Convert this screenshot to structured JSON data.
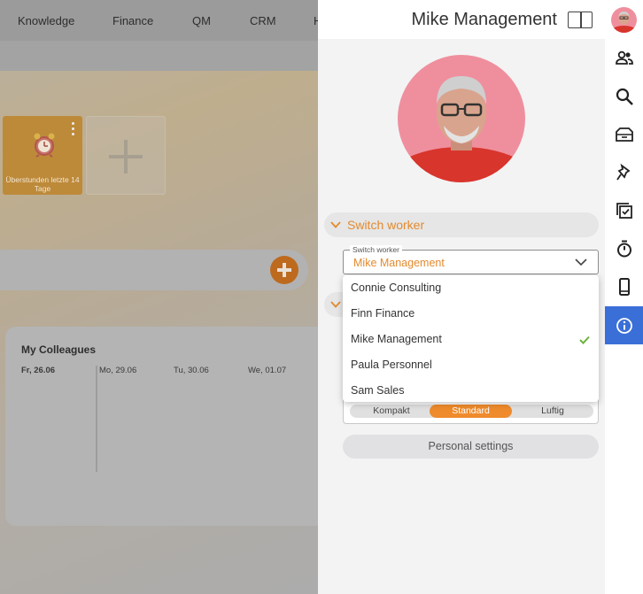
{
  "topnav": {
    "items": [
      "Knowledge",
      "Finance",
      "QM",
      "CRM",
      "H"
    ]
  },
  "dashboard": {
    "tile_label": "Überstunden letzte 14 Tage",
    "colleagues_title": "My Colleagues",
    "days": [
      "Fr, 26.06",
      "Mo, 29.06",
      "Tu, 30.06",
      "We, 01.07"
    ]
  },
  "panel": {
    "user_name": "Mike Management",
    "switch_section": "Switch worker",
    "select": {
      "label": "Switch worker",
      "value": "Mike Management"
    },
    "options": [
      {
        "label": "Connie Consulting",
        "selected": false
      },
      {
        "label": "Finn Finance",
        "selected": false
      },
      {
        "label": "Mike Management",
        "selected": true
      },
      {
        "label": "Paula Personnel",
        "selected": false
      },
      {
        "label": "Sam Sales",
        "selected": false
      }
    ],
    "density": {
      "options": [
        "Kompakt",
        "Standard",
        "Luftig"
      ],
      "selected": "Standard"
    },
    "personal_settings": "Personal settings"
  },
  "iconbar": {
    "icons": [
      "people-icon",
      "search-icon",
      "inbox-icon",
      "pin-icon",
      "checklist-icon",
      "stopwatch-icon",
      "mobile-icon",
      "info-icon"
    ],
    "active": "info-icon"
  },
  "colors": {
    "accent": "#e38a2e",
    "active_blue": "#3a6fd8",
    "check_green": "#6db33f"
  }
}
